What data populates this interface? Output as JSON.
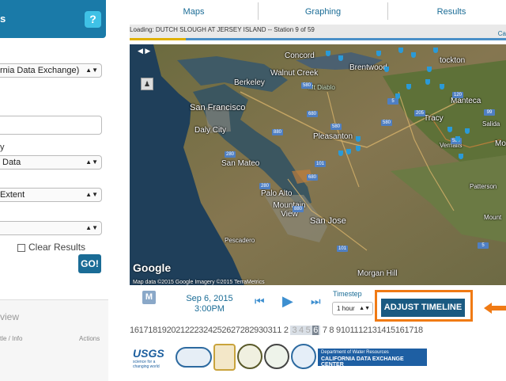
{
  "sidebar": {
    "header_label": "s",
    "help_label": "?",
    "source_select": "rnia Data Exchange)",
    "label_y": "y",
    "data_select": "Data",
    "extent_select": "Extent",
    "empty_select": "",
    "clear_results_label": "Clear Results",
    "go_label": "GO!",
    "overview_title": "view",
    "col_title_info": "tle / Info",
    "col_actions": "Actions"
  },
  "tabs": [
    "Maps",
    "Graphing",
    "Results"
  ],
  "loading": {
    "text": "Loading: DUTCH SLOUGH AT JERSEY ISLAND -- Station 9 of 59",
    "right_text": "Ca",
    "progress": 0.15
  },
  "map": {
    "labels": {
      "concord": "Concord",
      "walnut_creek": "Walnut Creek",
      "brentwood": "Brentwood",
      "berkeley": "Berkeley",
      "mt_diablo": "Mt Diablo",
      "san_francisco": "San Francisco",
      "daly_city": "Daly City",
      "pleasanton": "Pleasanton",
      "san_mateo": "San Mateo",
      "palo_alto": "Palo Alto",
      "mountain_view": "Mountain View",
      "san_jose": "San Jose",
      "pescadero": "Pescadero",
      "morgan_hill": "Morgan Hill",
      "stockton": "tockton",
      "manteca": "Manteca",
      "tracy": "Tracy",
      "salida": "Salida",
      "vernalis": "Vernalis",
      "patterson": "Patterson",
      "modesto": "Mo",
      "mount": "Mount"
    },
    "highways": [
      "580",
      "680",
      "580",
      "580",
      "205",
      "5",
      "680",
      "880",
      "280",
      "101",
      "280",
      "880",
      "101",
      "5",
      "580",
      "120",
      "99"
    ],
    "google_logo": "Google",
    "attribution": "Map data ©2015 Google Imagery ©2015 TerraMetrics"
  },
  "controls": {
    "m_label": "M",
    "date_line1": "Sep 6, 2015",
    "date_line2": "3:00PM",
    "timestep_label": "Timestep",
    "timestep_value": "1 hour",
    "adjust_label": "ADJUST TIMELINE",
    "prev_icon": "skip-back-icon",
    "play_icon": "play-icon",
    "next_icon": "skip-forward-icon"
  },
  "timeline": {
    "before": [
      "16",
      "17",
      "18",
      "19",
      "20",
      "21",
      "22",
      "23",
      "24",
      "25",
      "26",
      "27",
      "28",
      "29",
      "30",
      "31",
      "1",
      "2"
    ],
    "selected_before": [
      "3",
      "4",
      "5"
    ],
    "active": "6",
    "after": [
      "7",
      "8",
      "9",
      "10",
      "11",
      "12",
      "13",
      "14",
      "15",
      "16",
      "17",
      "18"
    ]
  },
  "logos": {
    "usgs_text": "USGS",
    "usgs_sub": "science for a changing world",
    "dwr_line1": "Department of Water Resources",
    "dwr_line2": "CALIFORNIA DATA EXCHANGE CENTER"
  },
  "colors": {
    "primary": "#1a6c96",
    "header": "#1a7aa8",
    "accent": "#f07a14",
    "marker": "#2a9ad8"
  }
}
